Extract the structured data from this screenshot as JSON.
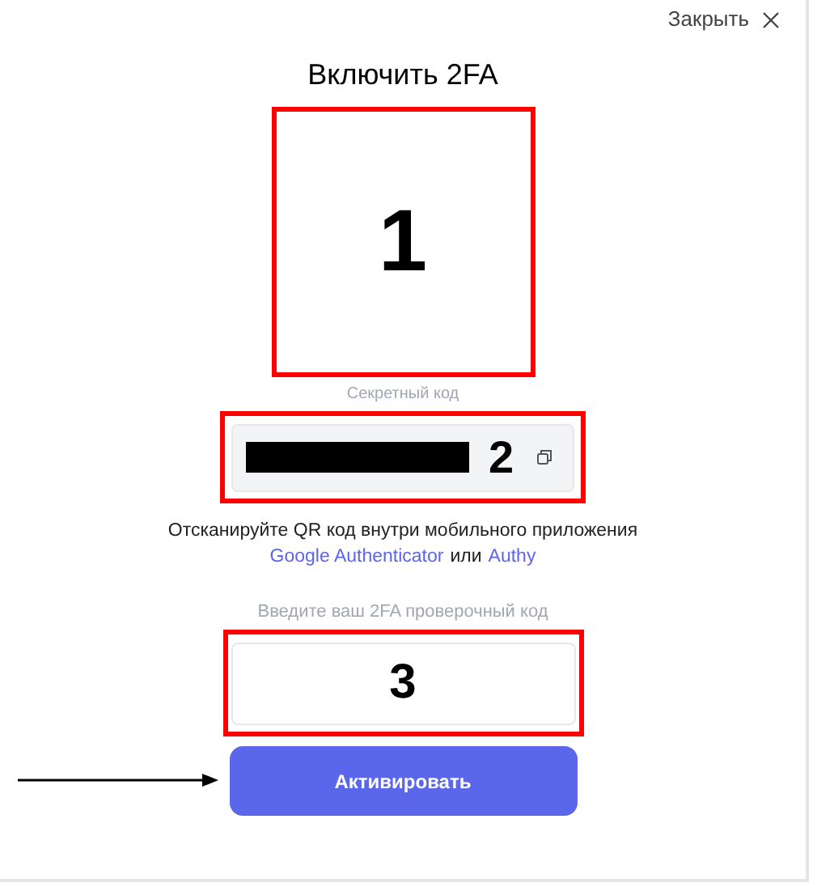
{
  "close": {
    "label": "Закрыть"
  },
  "title": "Включить 2FA",
  "annotations": [
    {
      "label": "1"
    },
    {
      "label": "2"
    },
    {
      "label": "3"
    }
  ],
  "secret": {
    "label": "Секретный код"
  },
  "instruction": {
    "text": "Отсканируйте QR код внутри мобильного приложения",
    "links": [
      "Google Authenticator",
      "Authy"
    ],
    "joiner": "или"
  },
  "code_field": {
    "label": "Введите ваш 2FA проверочный код"
  },
  "button": {
    "label": "Активировать"
  }
}
